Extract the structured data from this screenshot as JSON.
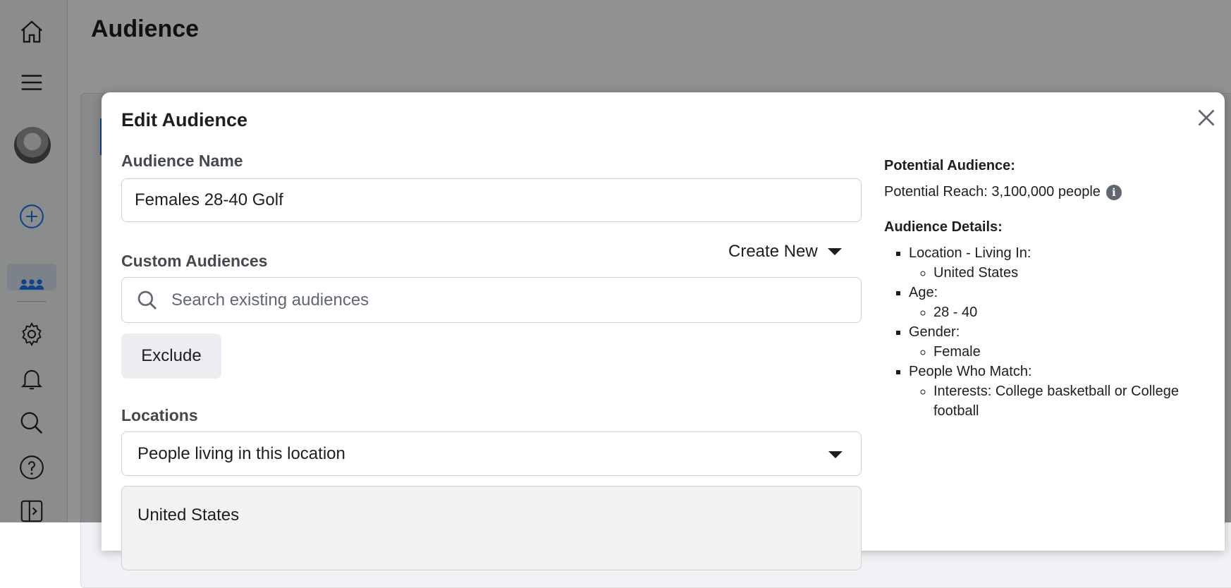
{
  "page": {
    "title": "Audience"
  },
  "sidebar": {
    "icons": [
      "home-icon",
      "menu-icon",
      "avatar",
      "add-icon",
      "audience-icon",
      "gear-icon",
      "bell-icon",
      "search-icon",
      "help-icon",
      "collapse-icon"
    ],
    "accent": "#1877f2"
  },
  "modal": {
    "title": "Edit Audience",
    "audience_name": {
      "label": "Audience Name",
      "value": "Females 28-40 Golf"
    },
    "custom_audiences": {
      "label": "Custom Audiences",
      "create_new": "Create New",
      "search_placeholder": "Search existing audiences",
      "exclude": "Exclude"
    },
    "locations": {
      "label": "Locations",
      "selected": "People living in this location",
      "chip": "United States"
    }
  },
  "summary": {
    "potential_heading": "Potential Audience:",
    "potential_reach": "Potential Reach: 3,100,000 people",
    "details_heading": "Audience Details:",
    "details": [
      {
        "label": "Location - Living In:",
        "value": "United States"
      },
      {
        "label": "Age:",
        "value": "28 - 40"
      },
      {
        "label": "Gender:",
        "value": "Female"
      },
      {
        "label": "People Who Match:",
        "value": "Interests: College basketball or College football"
      }
    ]
  }
}
